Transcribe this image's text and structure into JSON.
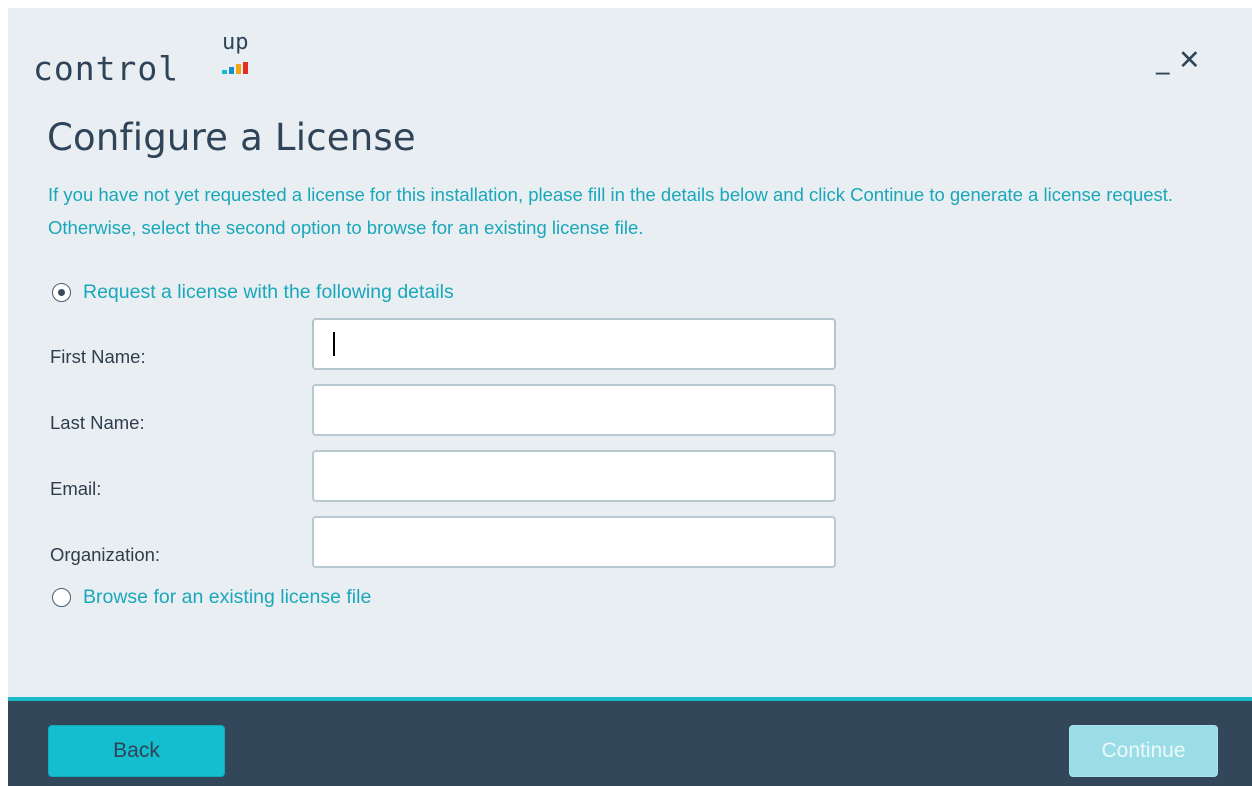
{
  "logo": {
    "text": "control",
    "superscript": "up",
    "bar_colors": [
      "#1bbbc9",
      "#1a8fd0",
      "#f2a516",
      "#e0311f"
    ]
  },
  "window_controls": {
    "minimize": "_",
    "close": "✕"
  },
  "page": {
    "title": "Configure a License",
    "description": "If you have not yet requested a license for this installation, please fill in the details below and click Continue to generate a license request. Otherwise, select the second option to browse for an existing license file."
  },
  "options": {
    "request": {
      "label": "Request a license with the following details",
      "checked": true
    },
    "browse": {
      "label": "Browse for an existing license file",
      "checked": false
    }
  },
  "form": {
    "first_name": {
      "label": "First Name:",
      "value": ""
    },
    "last_name": {
      "label": "Last Name:",
      "value": ""
    },
    "email": {
      "label": "Email:",
      "value": ""
    },
    "organization": {
      "label": "Organization:",
      "value": ""
    }
  },
  "footer": {
    "back_label": "Back",
    "continue_label": "Continue",
    "continue_enabled": false
  },
  "colors": {
    "accent": "#1bbbc9",
    "footer_bg": "#33475b",
    "window_bg": "#e8eef1",
    "text_dark": "#2f4458",
    "text_accent": "#1aa7ba"
  }
}
